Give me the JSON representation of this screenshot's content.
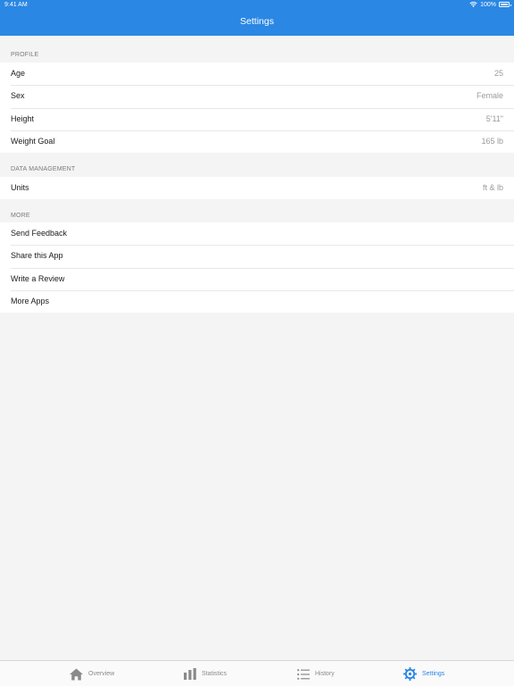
{
  "status": {
    "time": "9:41 AM",
    "battery": "100%"
  },
  "nav": {
    "title": "Settings"
  },
  "sections": {
    "profile": {
      "header": "PROFILE",
      "rows": [
        {
          "label": "Age",
          "value": "25"
        },
        {
          "label": "Sex",
          "value": "Female"
        },
        {
          "label": "Height",
          "value": "5'11\""
        },
        {
          "label": "Weight Goal",
          "value": "165 lb"
        }
      ]
    },
    "data_management": {
      "header": "DATA MANAGEMENT",
      "rows": [
        {
          "label": "Units",
          "value": "ft & lb"
        }
      ]
    },
    "more": {
      "header": "MORE",
      "rows": [
        {
          "label": "Send Feedback"
        },
        {
          "label": "Share this App"
        },
        {
          "label": "Write a Review"
        },
        {
          "label": "More Apps"
        }
      ]
    }
  },
  "tabs": [
    {
      "label": "Overview",
      "icon": "home-icon",
      "active": false
    },
    {
      "label": "Statistics",
      "icon": "bar-chart-icon",
      "active": false
    },
    {
      "label": "History",
      "icon": "list-icon",
      "active": false
    },
    {
      "label": "Settings",
      "icon": "gear-icon",
      "active": true
    }
  ],
  "colors": {
    "accent": "#2a87e4",
    "background": "#f4f4f4",
    "value_text": "#9b9b9b"
  }
}
